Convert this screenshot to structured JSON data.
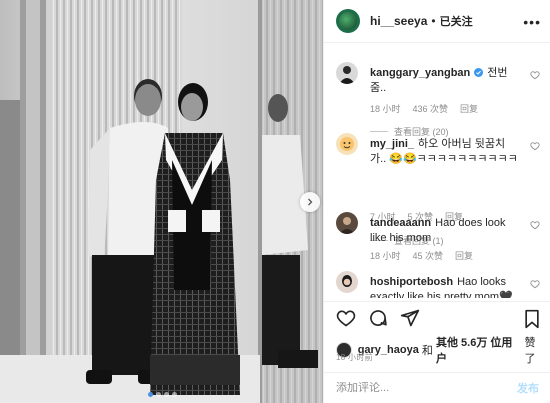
{
  "post": {
    "author": "hi__seeya",
    "separator": "•",
    "follow_label": "已关注",
    "more_icon": "more-dots-icon"
  },
  "comments": [
    {
      "username": "kanggary_yangban",
      "verified": true,
      "text": "전번줌..",
      "time": "18 小时",
      "likes": "436 次赞",
      "reply_label": "回复",
      "view_replies": "查看回复 (20)"
    },
    {
      "username": "my_jini_",
      "text": "하오 아버님 뒷꿈치가.. 😂😂ㅋㅋㅋㅋㅋㅋㅋㅋㅋㅋ",
      "time": "7 小时",
      "likes": "5 次赞",
      "reply_label": "回复",
      "view_replies": "查看回复 (1)"
    },
    {
      "username": "tandeaaann",
      "text": "Hao does look like his mom",
      "time": "18 小时",
      "likes": "45 次赞",
      "reply_label": "回复"
    },
    {
      "username": "hoshiportebosh",
      "text": "Hao looks exactly like his pretty mom🖤"
    }
  ],
  "actions": [
    "heart-icon",
    "comment-icon",
    "share-icon",
    "bookmark-icon"
  ],
  "likes": {
    "user": "gary_haoya",
    "and": "和",
    "others": "其他 5.6万 位用户",
    "suffix": "赞了"
  },
  "timestamp": "18 小时前",
  "comment_input": {
    "placeholder": "添加评论...",
    "post_label": "发布"
  },
  "carousel": {
    "slides": 4,
    "active": 0
  },
  "colors": {
    "follow": "#262626",
    "post_button": "#b2dffc",
    "verified": "#3897f0",
    "dot_active": "#4a90e2"
  }
}
